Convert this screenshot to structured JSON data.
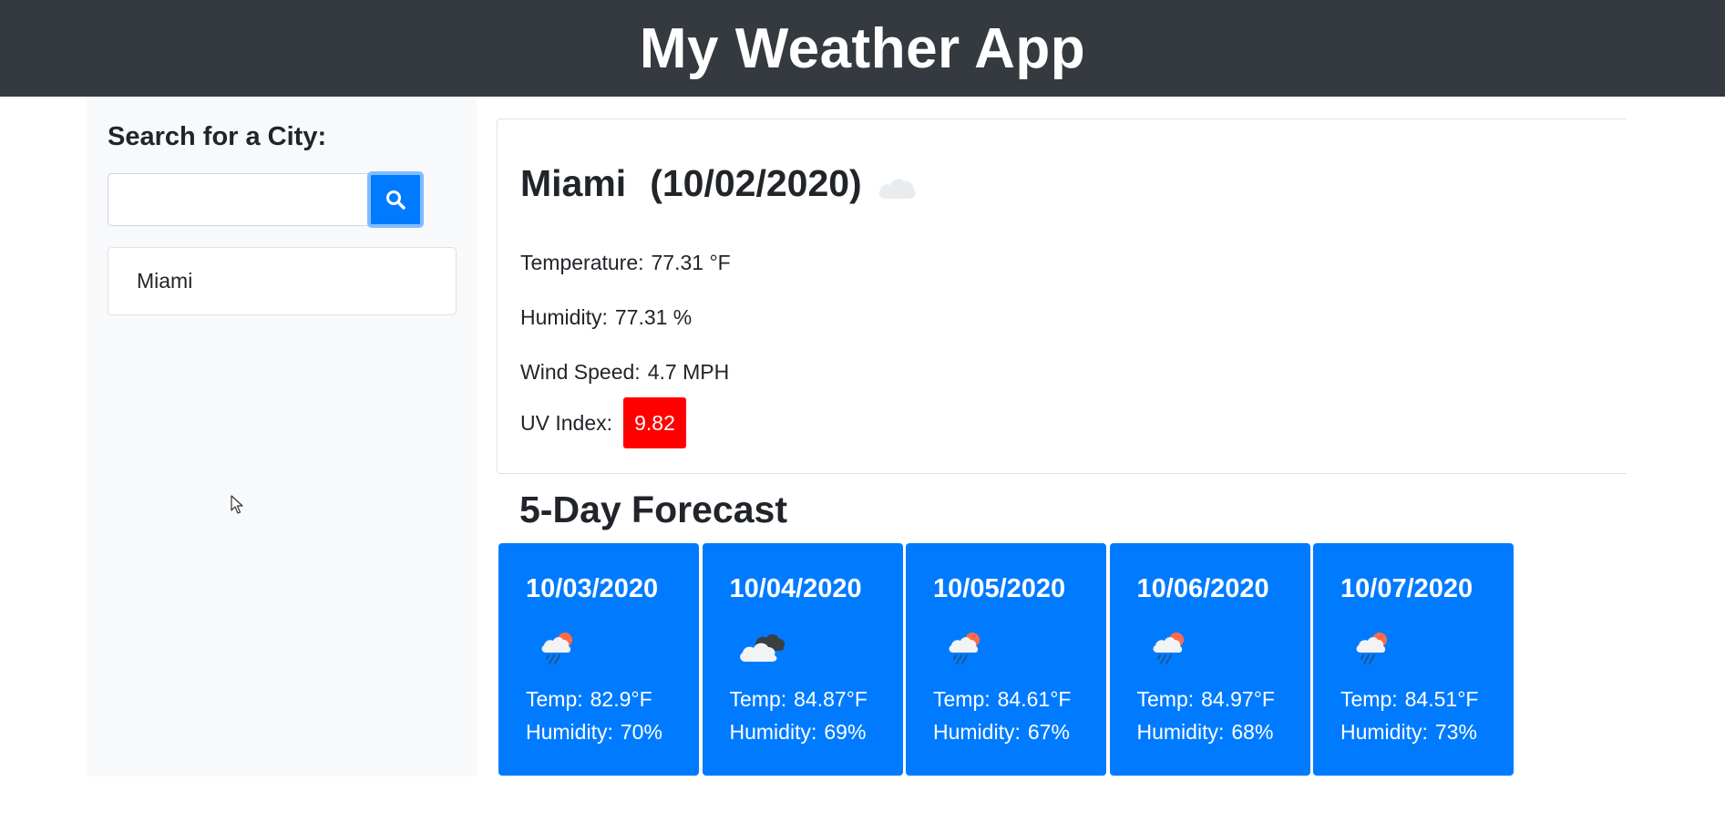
{
  "header": {
    "title": "My Weather App"
  },
  "sidebar": {
    "heading": "Search for a City:",
    "search": {
      "value": "",
      "placeholder": ""
    },
    "cities": [
      "Miami"
    ]
  },
  "current": {
    "city": "Miami",
    "date": "(10/02/2020)",
    "icon": "cloud-icon",
    "temperature": {
      "label": "Temperature:",
      "value": "77.31 °F"
    },
    "humidity": {
      "label": "Humidity:",
      "value": "77.31 %"
    },
    "wind": {
      "label": "Wind Speed:",
      "value": "4.7 MPH"
    },
    "uv": {
      "label": "UV Index:",
      "value": "9.82",
      "color": "#ff0000"
    }
  },
  "forecast": {
    "heading": "5-Day Forecast",
    "temp_label": "Temp:",
    "humidity_label": "Humidity:",
    "days": [
      {
        "date": "10/03/2020",
        "icon": "rain-sun-icon",
        "temp": "82.9°F",
        "humidity": "70%"
      },
      {
        "date": "10/04/2020",
        "icon": "broken-clouds-icon",
        "temp": "84.87°F",
        "humidity": "69%"
      },
      {
        "date": "10/05/2020",
        "icon": "rain-sun-icon",
        "temp": "84.61°F",
        "humidity": "67%"
      },
      {
        "date": "10/06/2020",
        "icon": "rain-sun-icon",
        "temp": "84.97°F",
        "humidity": "68%"
      },
      {
        "date": "10/07/2020",
        "icon": "rain-sun-icon",
        "temp": "84.51°F",
        "humidity": "73%"
      }
    ]
  },
  "colors": {
    "accent": "#007bff",
    "header_bg": "#343a40",
    "sidebar_bg": "#f8f9fa",
    "uv_high": "#ff0000"
  }
}
